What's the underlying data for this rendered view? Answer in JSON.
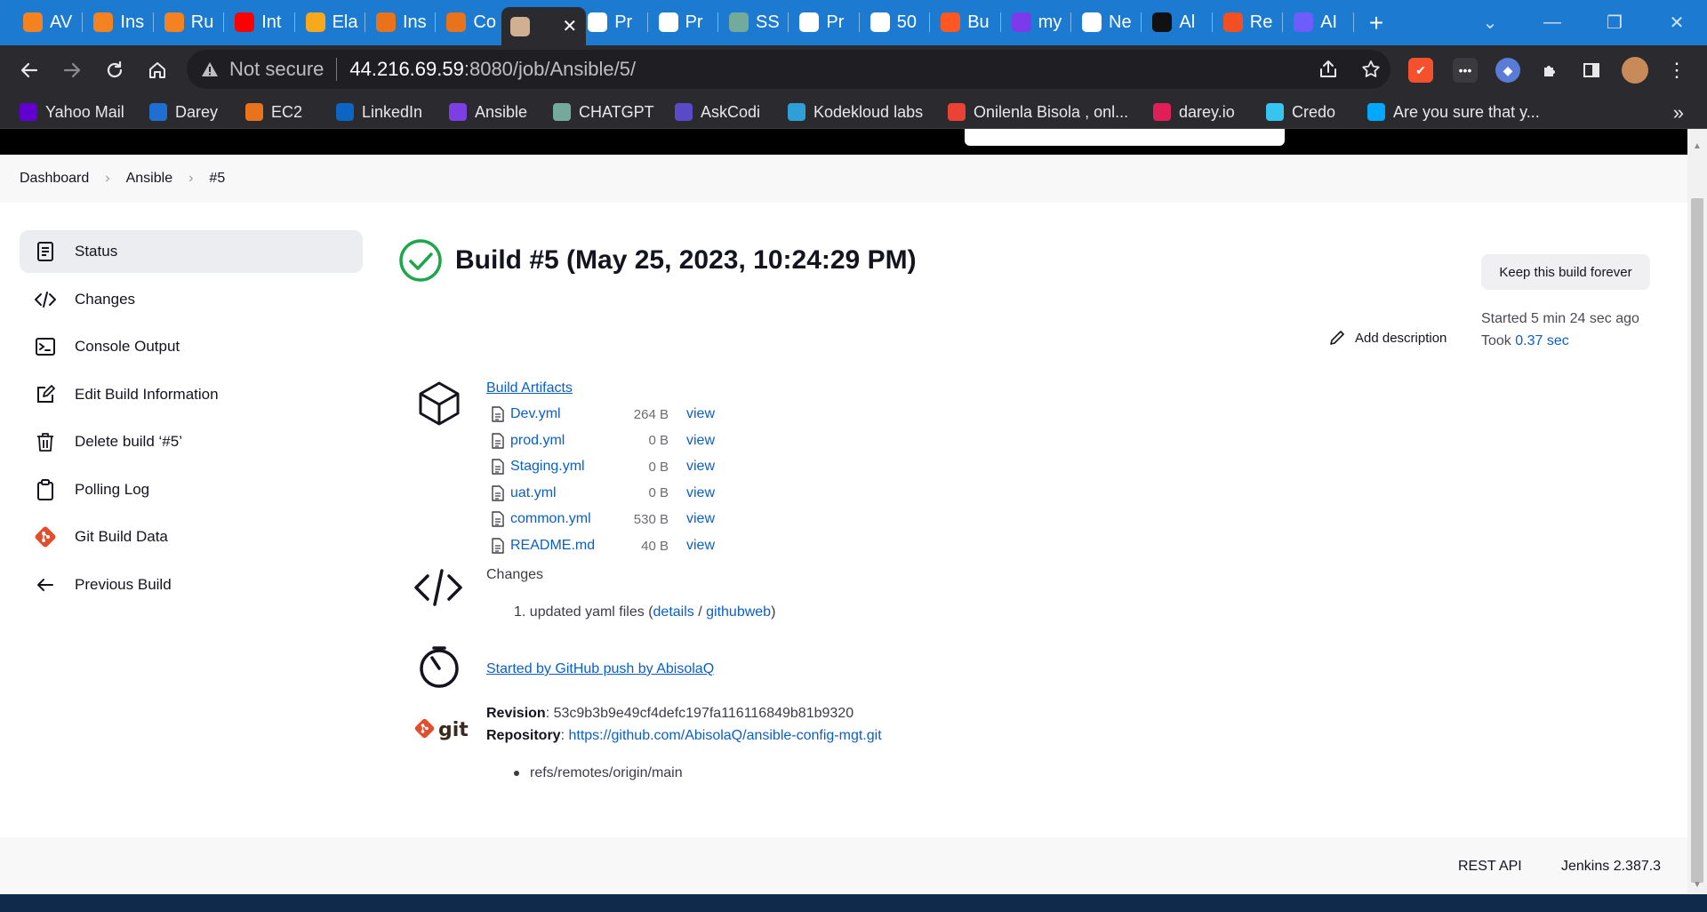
{
  "browser": {
    "tabs": [
      {
        "label": "AV",
        "icon": "darey-icon",
        "color": "#f58220"
      },
      {
        "label": "Ins",
        "icon": "darey-icon",
        "color": "#f58220"
      },
      {
        "label": "Ru",
        "icon": "darey-icon",
        "color": "#f58220"
      },
      {
        "label": "Int",
        "icon": "youtube-icon",
        "color": "#ff0000"
      },
      {
        "label": "Ela",
        "icon": "aws-icon",
        "color": "#f7a81b"
      },
      {
        "label": "Ins",
        "icon": "aws-icon",
        "color": "#e8731a"
      },
      {
        "label": "Co",
        "icon": "aws-icon",
        "color": "#e8731a"
      },
      {
        "label": "",
        "icon": "jenkins-icon",
        "color": "#d0b090",
        "active": true
      },
      {
        "label": "Pr",
        "icon": "globe-icon",
        "color": "#ffffff"
      },
      {
        "label": "Pr",
        "icon": "globe-icon",
        "color": "#ffffff"
      },
      {
        "label": "SS",
        "icon": "chatgpt-icon",
        "color": "#74aa9c"
      },
      {
        "label": "Pr",
        "icon": "globe-icon",
        "color": "#ffffff"
      },
      {
        "label": "50",
        "icon": "google-icon",
        "color": "#ffffff"
      },
      {
        "label": "Bu",
        "icon": "fav-icon",
        "color": "#ff5722"
      },
      {
        "label": "my",
        "icon": "fav-icon",
        "color": "#7c3aed"
      },
      {
        "label": "Ne",
        "icon": "chrome-icon",
        "color": "#ffffff"
      },
      {
        "label": "Al",
        "icon": "github-icon",
        "color": "#111111"
      },
      {
        "label": "Re",
        "icon": "microsoft-icon",
        "color": "#f25022"
      },
      {
        "label": "AI",
        "icon": "fav-icon",
        "color": "#6d5dfc"
      }
    ],
    "close_label": "✕",
    "new_tab_label": "+",
    "url": {
      "security": "Not secure",
      "host": "44.216.69.59",
      "path": ":8080/job/Ansible/5/"
    },
    "bookmarks": [
      {
        "label": "Yahoo Mail",
        "icon": "yahoo-icon",
        "color": "#6001d2"
      },
      {
        "label": "Darey",
        "icon": "darey-icon",
        "color": "#1f6fd1"
      },
      {
        "label": "EC2",
        "icon": "aws-icon",
        "color": "#e8731a"
      },
      {
        "label": "LinkedIn",
        "icon": "linkedin-icon",
        "color": "#0a66c2"
      },
      {
        "label": "Ansible",
        "icon": "ansible-icon",
        "color": "#7b3fe4"
      },
      {
        "label": "CHATGPT",
        "icon": "chatgpt-icon",
        "color": "#74aa9c"
      },
      {
        "label": "AskCodi",
        "icon": "askcodi-icon",
        "color": "#5b4ac7"
      },
      {
        "label": "Kodekloud labs",
        "icon": "kodekloud-icon",
        "color": "#2f9fd8"
      },
      {
        "label": "Onilenla Bisola , onl...",
        "icon": "gmail-icon",
        "color": "#ea4335"
      },
      {
        "label": "darey.io",
        "icon": "slack-icon",
        "color": "#e01e5a"
      },
      {
        "label": "Credo",
        "icon": "slack-icon",
        "color": "#36c5f0"
      },
      {
        "label": "Are you sure that y...",
        "icon": "circle-icon",
        "color": "#00a8ff"
      }
    ],
    "more_label": "»"
  },
  "breadcrumb": [
    "Dashboard",
    "Ansible",
    "#5"
  ],
  "sidebar": [
    {
      "label": "Status",
      "icon": "document-icon",
      "active": true
    },
    {
      "label": "Changes",
      "icon": "code-icon"
    },
    {
      "label": "Console Output",
      "icon": "terminal-icon"
    },
    {
      "label": "Edit Build Information",
      "icon": "edit-icon"
    },
    {
      "label": "Delete build ‘#5’",
      "icon": "trash-icon"
    },
    {
      "label": "Polling Log",
      "icon": "clipboard-icon"
    },
    {
      "label": "Git Build Data",
      "icon": "git-icon"
    },
    {
      "label": "Previous Build",
      "icon": "arrow-left-icon"
    }
  ],
  "build": {
    "title": "Build #5 (May 25, 2023, 10:24:29 PM)",
    "keep_label": "Keep this build forever",
    "started": "Started 5 min 24 sec ago",
    "took_prefix": "Took",
    "took_value": "0.37 sec",
    "add_description": "Add description",
    "status_color": "#1ea64b"
  },
  "artifacts": {
    "title": "Build Artifacts",
    "view_label": "view",
    "files": [
      {
        "name": "Dev.yml",
        "size": "264 B"
      },
      {
        "name": "prod.yml",
        "size": "0 B"
      },
      {
        "name": "Staging.yml",
        "size": "0 B"
      },
      {
        "name": "uat.yml",
        "size": "0 B"
      },
      {
        "name": "common.yml",
        "size": "530 B"
      },
      {
        "name": "README.md",
        "size": "40 B"
      }
    ]
  },
  "changes": {
    "label": "Changes",
    "item_text": "1. updated yaml files (",
    "details": "details",
    "sep": " / ",
    "githubweb": "githubweb",
    "close": ")"
  },
  "cause": "Started by GitHub push by AbisolaQ",
  "git": {
    "logo_text": "git",
    "revision_label": "Revision",
    "revision": ": 53c9b3b9e49cf4defc197fa116116849b81b9320",
    "repository_label": "Repository",
    "repository_sep": ": ",
    "repository": "https://github.com/AbisolaQ/ansible-config-mgt.git",
    "branch": "refs/remotes/origin/main"
  },
  "footer": {
    "rest_api": "REST API",
    "version": "Jenkins 2.387.3"
  }
}
